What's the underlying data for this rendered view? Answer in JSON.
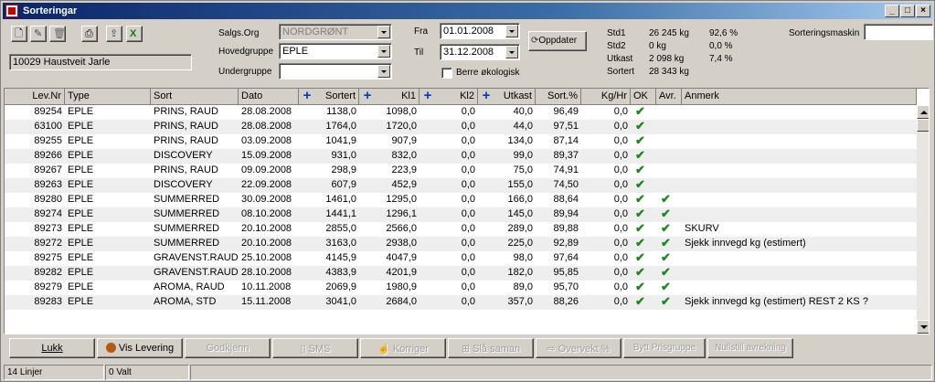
{
  "window": {
    "title": "Sorteringar"
  },
  "user_field": "10029 Haustveit Jarle",
  "filters": {
    "salgs_org_label": "Salgs.Org",
    "salgs_org_value": "NORDGRØNT",
    "hovedgruppe_label": "Hovedgruppe",
    "hovedgruppe_value": "EPLE",
    "undergruppe_label": "Undergruppe",
    "undergruppe_value": "",
    "fra_label": "Fra",
    "fra_value": "01.01.2008",
    "til_label": "Til",
    "til_value": "31.12.2008",
    "oppdater_label": "Oppdater",
    "berre_label": "Berre økologisk"
  },
  "stats": {
    "std1_label": "Std1",
    "std1_kg": "26 245 kg",
    "std1_pct": "92,6 %",
    "std2_label": "Std2",
    "std2_kg": "0 kg",
    "std2_pct": "0,0 %",
    "utkast_label": "Utkast",
    "utkast_kg": "2 098 kg",
    "utkast_pct": "7,4 %",
    "sortert_label": "Sortert",
    "sortert_kg": "28 343 kg"
  },
  "sorteringsmaskin_label": "Sorteringsmaskin",
  "sorteringsmaskin_value": "",
  "columns": [
    "Lev.Nr",
    "Type",
    "Sort",
    "Dato",
    "Sortert",
    "Kl1",
    "Kl2",
    "Utkast",
    "Sort.%",
    "Kg/Hr",
    "OK",
    "Avr.",
    "Anmerk"
  ],
  "rows": [
    {
      "levnr": "89254",
      "type": "EPLE",
      "sort": "PRINS, RAUD",
      "dato": "28.08.2008",
      "sortert": "1138,0",
      "kl1": "1098,0",
      "kl2": "0,0",
      "utkast": "40,0",
      "sortpct": "96,49",
      "kghr": "0,0",
      "ok": "✔",
      "avr": "",
      "anmerk": ""
    },
    {
      "levnr": "63100",
      "type": "EPLE",
      "sort": "PRINS, RAUD",
      "dato": "28.08.2008",
      "sortert": "1764,0",
      "kl1": "1720,0",
      "kl2": "0,0",
      "utkast": "44,0",
      "sortpct": "97,51",
      "kghr": "0,0",
      "ok": "✔",
      "avr": "",
      "anmerk": ""
    },
    {
      "levnr": "89255",
      "type": "EPLE",
      "sort": "PRINS, RAUD",
      "dato": "03.09.2008",
      "sortert": "1041,9",
      "kl1": "907,9",
      "kl2": "0,0",
      "utkast": "134,0",
      "sortpct": "87,14",
      "kghr": "0,0",
      "ok": "✔",
      "avr": "",
      "anmerk": ""
    },
    {
      "levnr": "89266",
      "type": "EPLE",
      "sort": "DISCOVERY",
      "dato": "15.09.2008",
      "sortert": "931,0",
      "kl1": "832,0",
      "kl2": "0,0",
      "utkast": "99,0",
      "sortpct": "89,37",
      "kghr": "0,0",
      "ok": "✔",
      "avr": "",
      "anmerk": ""
    },
    {
      "levnr": "89267",
      "type": "EPLE",
      "sort": "PRINS, RAUD",
      "dato": "09.09.2008",
      "sortert": "298,9",
      "kl1": "223,9",
      "kl2": "0,0",
      "utkast": "75,0",
      "sortpct": "74,91",
      "kghr": "0,0",
      "ok": "✔",
      "avr": "",
      "anmerk": ""
    },
    {
      "levnr": "89263",
      "type": "EPLE",
      "sort": "DISCOVERY",
      "dato": "22.09.2008",
      "sortert": "607,9",
      "kl1": "452,9",
      "kl2": "0,0",
      "utkast": "155,0",
      "sortpct": "74,50",
      "kghr": "0,0",
      "ok": "✔",
      "avr": "",
      "anmerk": ""
    },
    {
      "levnr": "89280",
      "type": "EPLE",
      "sort": "SUMMERRED",
      "dato": "30.09.2008",
      "sortert": "1461,0",
      "kl1": "1295,0",
      "kl2": "0,0",
      "utkast": "166,0",
      "sortpct": "88,64",
      "kghr": "0,0",
      "ok": "✔",
      "avr": "✔",
      "anmerk": ""
    },
    {
      "levnr": "89274",
      "type": "EPLE",
      "sort": "SUMMERRED",
      "dato": "08.10.2008",
      "sortert": "1441,1",
      "kl1": "1296,1",
      "kl2": "0,0",
      "utkast": "145,0",
      "sortpct": "89,94",
      "kghr": "0,0",
      "ok": "✔",
      "avr": "✔",
      "anmerk": ""
    },
    {
      "levnr": "89273",
      "type": "EPLE",
      "sort": "SUMMERRED",
      "dato": "20.10.2008",
      "sortert": "2855,0",
      "kl1": "2566,0",
      "kl2": "0,0",
      "utkast": "289,0",
      "sortpct": "89,88",
      "kghr": "0,0",
      "ok": "✔",
      "avr": "✔",
      "anmerk": "SKURV"
    },
    {
      "levnr": "89272",
      "type": "EPLE",
      "sort": "SUMMERRED",
      "dato": "20.10.2008",
      "sortert": "3163,0",
      "kl1": "2938,0",
      "kl2": "0,0",
      "utkast": "225,0",
      "sortpct": "92,89",
      "kghr": "0,0",
      "ok": "✔",
      "avr": "✔",
      "anmerk": "Sjekk innvegd kg (estimert)"
    },
    {
      "levnr": "89275",
      "type": "EPLE",
      "sort": "GRAVENST.RAUD",
      "dato": "25.10.2008",
      "sortert": "4145,9",
      "kl1": "4047,9",
      "kl2": "0,0",
      "utkast": "98,0",
      "sortpct": "97,64",
      "kghr": "0,0",
      "ok": "✔",
      "avr": "✔",
      "anmerk": ""
    },
    {
      "levnr": "89282",
      "type": "EPLE",
      "sort": "GRAVENST.RAUD",
      "dato": "28.10.2008",
      "sortert": "4383,9",
      "kl1": "4201,9",
      "kl2": "0,0",
      "utkast": "182,0",
      "sortpct": "95,85",
      "kghr": "0,0",
      "ok": "✔",
      "avr": "✔",
      "anmerk": ""
    },
    {
      "levnr": "89279",
      "type": "EPLE",
      "sort": "AROMA, RAUD",
      "dato": "10.11.2008",
      "sortert": "2069,9",
      "kl1": "1980,9",
      "kl2": "0,0",
      "utkast": "89,0",
      "sortpct": "95,70",
      "kghr": "0,0",
      "ok": "✔",
      "avr": "✔",
      "anmerk": ""
    },
    {
      "levnr": "89283",
      "type": "EPLE",
      "sort": "AROMA, STD",
      "dato": "15.11.2008",
      "sortert": "3041,0",
      "kl1": "2684,0",
      "kl2": "0,0",
      "utkast": "357,0",
      "sortpct": "88,26",
      "kghr": "0,0",
      "ok": "✔",
      "avr": "✔",
      "anmerk": "Sjekk innvegd kg (estimert) REST 2 KS ?"
    }
  ],
  "buttons": {
    "lukk": "Lukk",
    "vis_levering": "Vis Levering",
    "godkjenn": "Godkjenn",
    "sms": "SMS",
    "korriger": "Korriger",
    "sla_saman": "Slå saman",
    "overvekt": "Overvekt %",
    "bytt_prisgruppe": "Bytt Prisgruppe",
    "nullstill": "Nullstill avrekning"
  },
  "statusbar": {
    "lines": "14 Linjer",
    "selected": "0 Valt"
  },
  "colors": {
    "title_start": "#0a246a",
    "check": "#1a8a1a",
    "plus": "#0038c8"
  }
}
